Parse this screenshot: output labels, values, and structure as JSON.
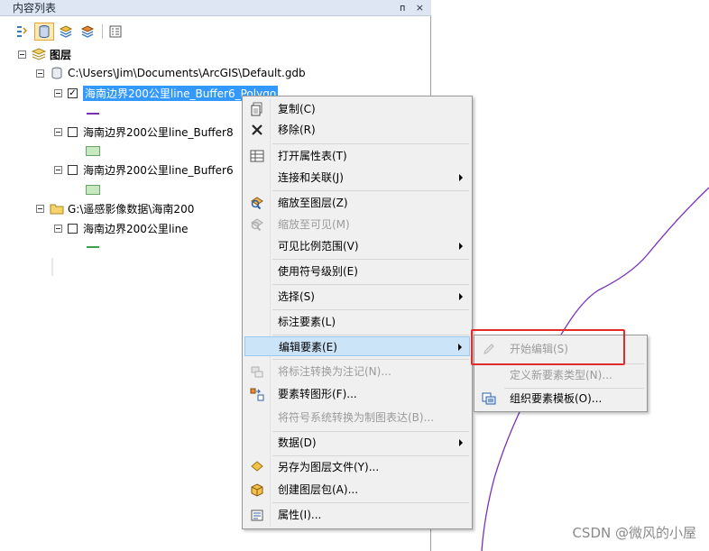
{
  "toc": {
    "title": "内容列表",
    "pin": "ᴨ",
    "close": "×",
    "layers_root": "图层",
    "gdb_path": "C:\\Users\\Jim\\Documents\\ArcGIS\\Default.gdb",
    "layer1": "海南边界200公里line_Buffer6_Polygo",
    "layer2": "海南边界200公里line_Buffer8",
    "layer3": "海南边界200公里line_Buffer6",
    "folder_path": "G:\\遥感影像数据\\海南200",
    "layer4": "海南边界200公里line"
  },
  "context_menu": {
    "items": [
      {
        "label": "复制(C)",
        "icon": "copy-icon"
      },
      {
        "label": "移除(R)",
        "icon": "remove-icon"
      },
      {
        "label": "打开属性表(T)",
        "icon": "table-icon"
      },
      {
        "label": "连接和关联(J)"
      },
      {
        "label": "缩放至图层(Z)",
        "icon": "zoom-layer-icon"
      },
      {
        "label": "缩放至可见(M)",
        "icon": "zoom-visible-icon",
        "disabled": true
      },
      {
        "label": "可见比例范围(V)"
      },
      {
        "label": "使用符号级别(E)"
      },
      {
        "label": "选择(S)"
      },
      {
        "label": "标注要素(L)"
      },
      {
        "label": "编辑要素(E)"
      },
      {
        "label": "将标注转换为注记(N)...",
        "disabled": true
      },
      {
        "label": "要素转图形(F)..."
      },
      {
        "label": "将符号系统转换为制图表达(B)...",
        "disabled": true
      },
      {
        "label": "数据(D)"
      },
      {
        "label": "另存为图层文件(Y)..."
      },
      {
        "label": "创建图层包(A)..."
      },
      {
        "label": "属性(I)..."
      }
    ]
  },
  "submenu": {
    "items": [
      {
        "label": "开始编辑(S)",
        "disabled": true
      },
      {
        "label": "定义新要素类型(N)...",
        "disabled": true
      },
      {
        "label": "组织要素模板(O)..."
      }
    ]
  },
  "colors": {
    "highlight_box": "#e22b2b",
    "selection": "#3399ff",
    "map_line": "#7a2fb8"
  },
  "watermark": "CSDN @微风的小屋"
}
